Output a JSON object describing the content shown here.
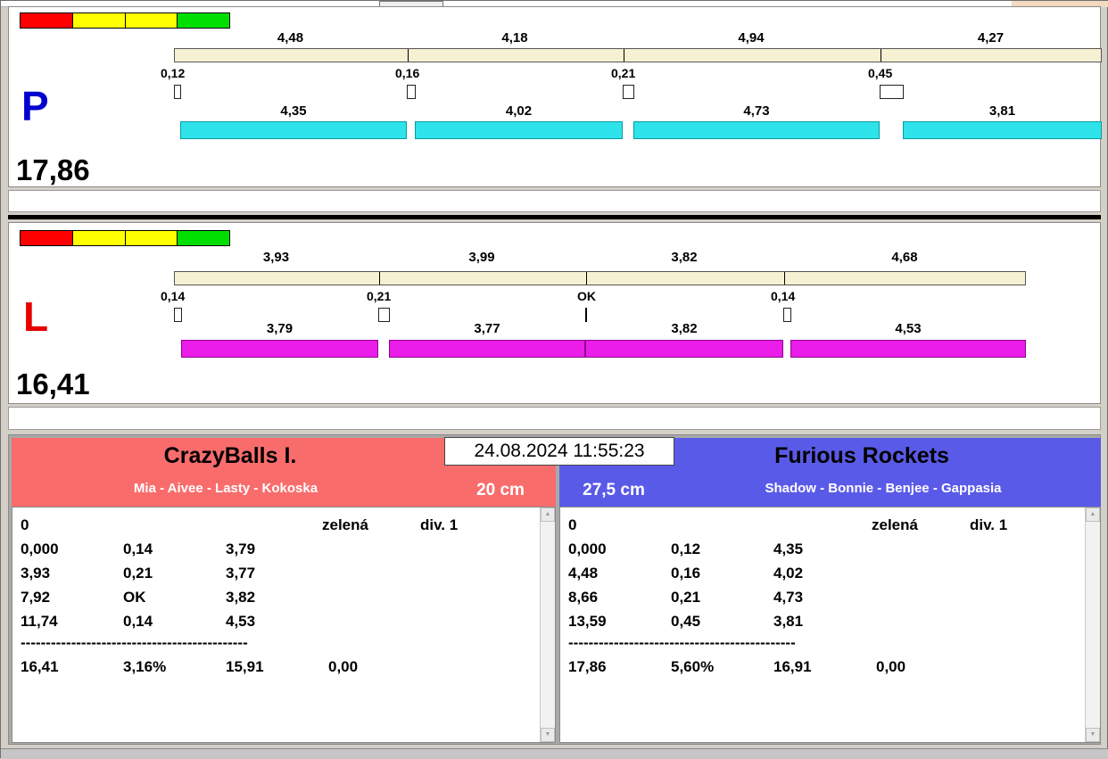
{
  "datetime": "24.08.2024 11:55:23",
  "traffic_light_colors": [
    "#ff0000",
    "#ffff00",
    "#ffff00",
    "#00df00"
  ],
  "lanes": {
    "p": {
      "label": "P",
      "label_color": "#0000d0",
      "total": "17,86",
      "splits": [
        "4,48",
        "4,18",
        "4,94",
        "4,27"
      ],
      "passes": [
        "0,12",
        "0,16",
        "0,21",
        "0,45"
      ],
      "runs": [
        "4,35",
        "4,02",
        "4,73",
        "3,81"
      ],
      "bar_color": "#2ee3ea"
    },
    "l": {
      "label": "L",
      "label_color": "#e80000",
      "total": "16,41",
      "splits": [
        "3,93",
        "3,99",
        "3,82",
        "4,68"
      ],
      "passes": [
        "0,14",
        "0,21",
        "OK",
        "0,14"
      ],
      "runs": [
        "3,79",
        "3,77",
        "3,82",
        "4,53"
      ],
      "bar_color": "#ea1de9"
    }
  },
  "teams": {
    "left": {
      "name": "CrazyBalls I.",
      "members": "Mia - Aivee - Lasty - Kokoska",
      "jump_height": "20 cm",
      "header_color": "#f96c6c",
      "status": {
        "value": "0",
        "light": "zelená",
        "division": "div. 1"
      },
      "rows": [
        [
          "0,000",
          "0,14",
          "3,79"
        ],
        [
          "3,93",
          "0,21",
          "3,77"
        ],
        [
          "7,92",
          "OK",
          "3,82"
        ],
        [
          "11,74",
          "0,14",
          "4,53"
        ]
      ],
      "separator": "---------------------------------------------",
      "summary": [
        "16,41",
        "3,16%",
        "15,91",
        "0,00"
      ]
    },
    "right": {
      "name": "Furious Rockets",
      "members": "Shadow - Bonnie - Benjee - Gappasia",
      "jump_height": "27,5 cm",
      "header_color": "#5a5ae8",
      "status": {
        "value": "0",
        "light": "zelená",
        "division": "div. 1"
      },
      "rows": [
        [
          "0,000",
          "0,12",
          "4,35"
        ],
        [
          "4,48",
          "0,16",
          "4,02"
        ],
        [
          "8,66",
          "0,21",
          "4,73"
        ],
        [
          "13,59",
          "0,45",
          "3,81"
        ]
      ],
      "separator": "---------------------------------------------",
      "summary": [
        "17,86",
        "5,60%",
        "16,91",
        "0,00"
      ]
    }
  }
}
